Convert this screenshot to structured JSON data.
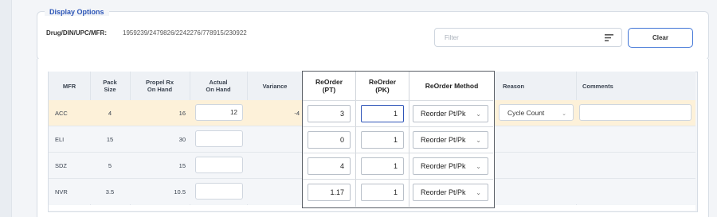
{
  "display_options": {
    "legend": "Display Options",
    "drug_label": "Drug/DIN/UPC/MFR:",
    "drug_value": "1959239/2479826/2242276/778915/230922",
    "filter_placeholder": "Filter",
    "clear_label": "Clear"
  },
  "table": {
    "headers": {
      "mfr": "MFR",
      "pack_size": "Pack\nSize",
      "propel_on_hand": "Propel Rx\nOn Hand",
      "actual_on_hand": "Actual\nOn Hand",
      "variance": "Variance",
      "reorder_pt": "ReOrder\n(PT)",
      "reorder_pk": "ReOrder\n(PK)",
      "reorder_method": "ReOrder Method",
      "reason": "Reason",
      "comments": "Comments"
    },
    "rows": [
      {
        "mfr": "ACC",
        "pack_size": "4",
        "propel_on_hand": "16",
        "actual_on_hand": "12",
        "variance": "-4",
        "reorder_pt": "3",
        "reorder_pk": "1",
        "reorder_method": "Reorder Pt/Pk",
        "reason": "Cycle Count",
        "comments": ""
      },
      {
        "mfr": "ELI",
        "pack_size": "15",
        "propel_on_hand": "30",
        "actual_on_hand": "",
        "variance": "",
        "reorder_pt": "0",
        "reorder_pk": "1",
        "reorder_method": "Reorder Pt/Pk",
        "reason": "",
        "comments": ""
      },
      {
        "mfr": "SDZ",
        "pack_size": "5",
        "propel_on_hand": "15",
        "actual_on_hand": "",
        "variance": "",
        "reorder_pt": "4",
        "reorder_pk": "1",
        "reorder_method": "Reorder Pt/Pk",
        "reason": "",
        "comments": ""
      },
      {
        "mfr": "NVR",
        "pack_size": "3.5",
        "propel_on_hand": "10.5",
        "actual_on_hand": "",
        "variance": "",
        "reorder_pt": "1.17",
        "reorder_pk": "1",
        "reorder_method": "Reorder Pt/Pk",
        "reason": "",
        "comments": ""
      }
    ]
  },
  "colors": {
    "accent": "#3f74d6",
    "legend": "#2d56b7",
    "selected_row": "#fdf1d9"
  },
  "icons": {
    "filter": "filter-lines-icon",
    "dropdown": "chevron-down-icon"
  }
}
